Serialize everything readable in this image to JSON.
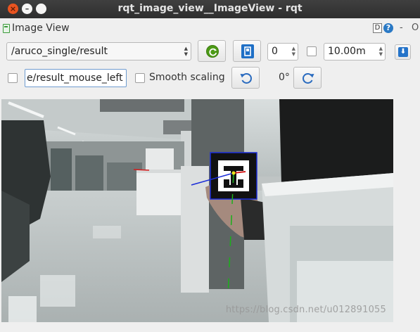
{
  "window": {
    "title": "rqt_image_view__ImageView - rqt",
    "close_glyph": "×",
    "min_glyph": "–",
    "max_glyph": ""
  },
  "plugin": {
    "title": "Image View",
    "d_label": "D",
    "help_label": "?",
    "dash_label": "-",
    "o_label": "O"
  },
  "toolbar": {
    "topic": "/aruco_single/result",
    "spin_value": "0",
    "max_range": "10.00m",
    "mouse_topic": "e/result_mouse_left",
    "smooth_label": "Smooth scaling",
    "rotation": "0°"
  },
  "watermark": "https://blog.csdn.net/u012891055",
  "colors": {
    "accent_green": "#4c9a16",
    "accent_blue": "#1e6fc6",
    "titlebar": "#363636",
    "close": "#e95420"
  }
}
